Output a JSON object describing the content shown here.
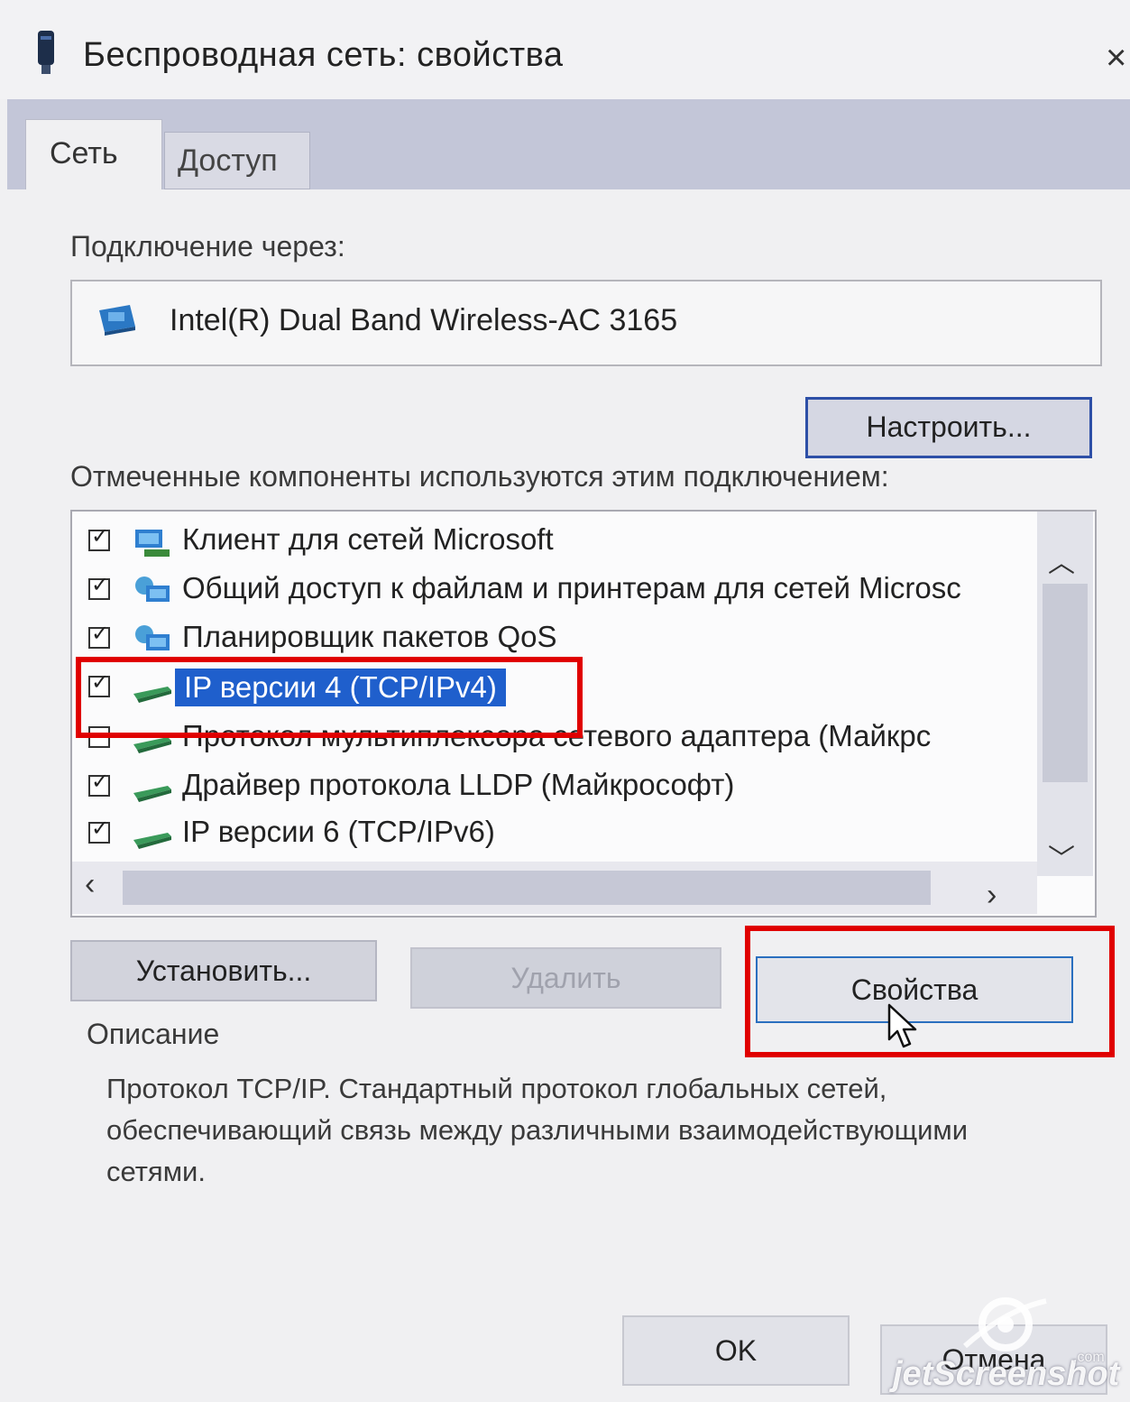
{
  "window": {
    "title": "Беспроводная сеть: свойства",
    "close_label": "×"
  },
  "tabs": [
    {
      "label": "Сеть",
      "active": true
    },
    {
      "label": "Доступ",
      "active": false
    }
  ],
  "connection": {
    "label": "Подключение через:",
    "adapter": "Intel(R) Dual Band Wireless-AC 3165",
    "configure_button": "Настроить..."
  },
  "components": {
    "label": "Отмеченные компоненты используются этим подключением:",
    "items": [
      {
        "label": "Клиент для сетей Microsoft",
        "checked": true,
        "icon": "network-client-icon"
      },
      {
        "label": "Общий доступ к файлам и принтерам для сетей Microsc",
        "checked": true,
        "icon": "network-service-icon"
      },
      {
        "label": "Планировщик пакетов QoS",
        "checked": true,
        "icon": "network-service-icon"
      },
      {
        "label": "IP версии 4 (TCP/IPv4)",
        "checked": true,
        "selected": true,
        "icon": "protocol-icon"
      },
      {
        "label": "Протокол мультиплексора сетевого адаптера (Майкрс",
        "checked": false,
        "icon": "protocol-icon"
      },
      {
        "label": "Драйвер протокола LLDP (Майкрософт)",
        "checked": true,
        "icon": "protocol-icon"
      },
      {
        "label": "IP версии 6 (TCP/IPv6)",
        "checked": true,
        "icon": "protocol-icon"
      }
    ]
  },
  "buttons": {
    "install": "Установить...",
    "remove": "Удалить",
    "properties": "Свойства",
    "ok": "OK",
    "cancel": "Отмена"
  },
  "description": {
    "label": "Описание",
    "text": "Протокол TCP/IP. Стандартный протокол глобальных сетей, обеспечивающий связь между различными взаимодействующими сетями."
  },
  "watermark": {
    "text": "jetScreenshot",
    "suffix": ".com"
  },
  "colors": {
    "selection": "#1f5fcc",
    "highlight": "#e00000",
    "tabstrip": "#c3c6d8"
  }
}
